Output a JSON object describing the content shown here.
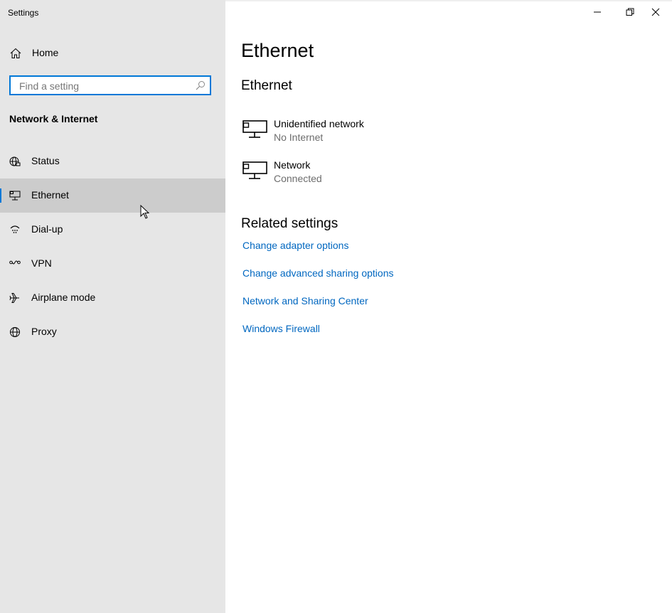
{
  "window": {
    "title": "Settings"
  },
  "sidebar": {
    "home_label": "Home",
    "search_placeholder": "Find a setting",
    "section_title": "Network & Internet",
    "items": [
      {
        "label": "Status",
        "icon": "globe-status-icon"
      },
      {
        "label": "Ethernet",
        "icon": "ethernet-icon",
        "selected": true
      },
      {
        "label": "Dial-up",
        "icon": "dial-up-icon"
      },
      {
        "label": "VPN",
        "icon": "vpn-icon"
      },
      {
        "label": "Airplane mode",
        "icon": "airplane-icon"
      },
      {
        "label": "Proxy",
        "icon": "globe-icon"
      }
    ]
  },
  "main": {
    "title": "Ethernet",
    "subtitle": "Ethernet",
    "networks": [
      {
        "name": "Unidentified network",
        "status": "No Internet"
      },
      {
        "name": "Network",
        "status": "Connected"
      }
    ],
    "related_title": "Related settings",
    "related_links": [
      "Change adapter options",
      "Change advanced sharing options",
      "Network and Sharing Center",
      "Windows Firewall"
    ]
  },
  "colors": {
    "accent": "#0078d7",
    "link": "#0067c0",
    "sidebar_bg": "#e6e6e6",
    "selected_bg": "#cccccc"
  }
}
